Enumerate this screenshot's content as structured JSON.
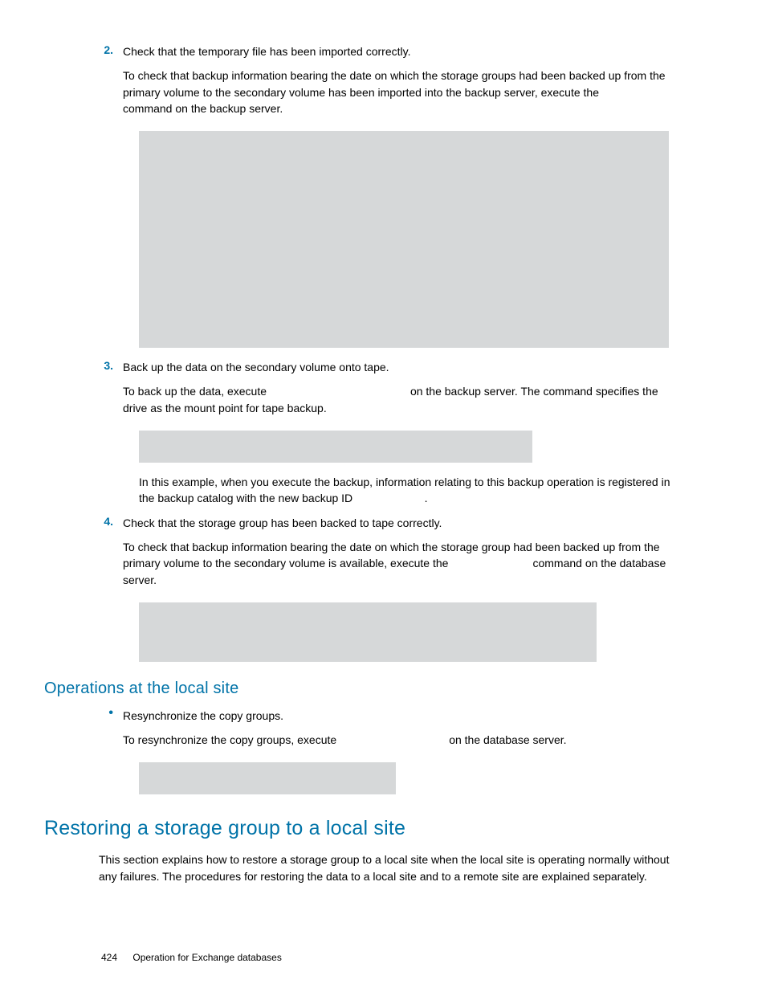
{
  "list": {
    "items": [
      {
        "marker": "2.",
        "title": "Check that the temporary file has been imported correctly.",
        "para": "To check that backup information bearing the date on which the storage groups had been backed up from the primary volume to the secondary volume has been imported into the backup server, execute the",
        "para_tail": "command on the backup server."
      },
      {
        "marker": "3.",
        "title": "Back up the data on the secondary volume onto tape.",
        "para_a": "To back up the data, execute",
        "para_b": "on the backup server. The command specifies the",
        "para_c": "drive as the mount point for tape backup.",
        "after_a": "In this example, when you execute the backup, information relating to this backup operation is registered in the backup catalog with the new backup ID",
        "after_b": "."
      },
      {
        "marker": "4.",
        "title": "Check that the storage group has been backed to tape correctly.",
        "para": "To check that backup information bearing the date on which the storage group had been backed up from the primary volume to the secondary volume is available, execute the",
        "para_tail": "command on the database server."
      }
    ]
  },
  "subsection": {
    "heading": "Operations at the local site",
    "bullet_title": "Resynchronize the copy groups.",
    "bullet_para_a": "To resynchronize the copy groups, execute",
    "bullet_para_b": "on the database server."
  },
  "section": {
    "heading": "Restoring a storage group to a local site",
    "para": "This section explains how to restore a storage group to a local site when the local site is operating normally without any failures. The procedures for restoring the data to a local site and to a remote site are explained separately."
  },
  "footer": {
    "page": "424",
    "chapter": "Operation for Exchange databases"
  }
}
